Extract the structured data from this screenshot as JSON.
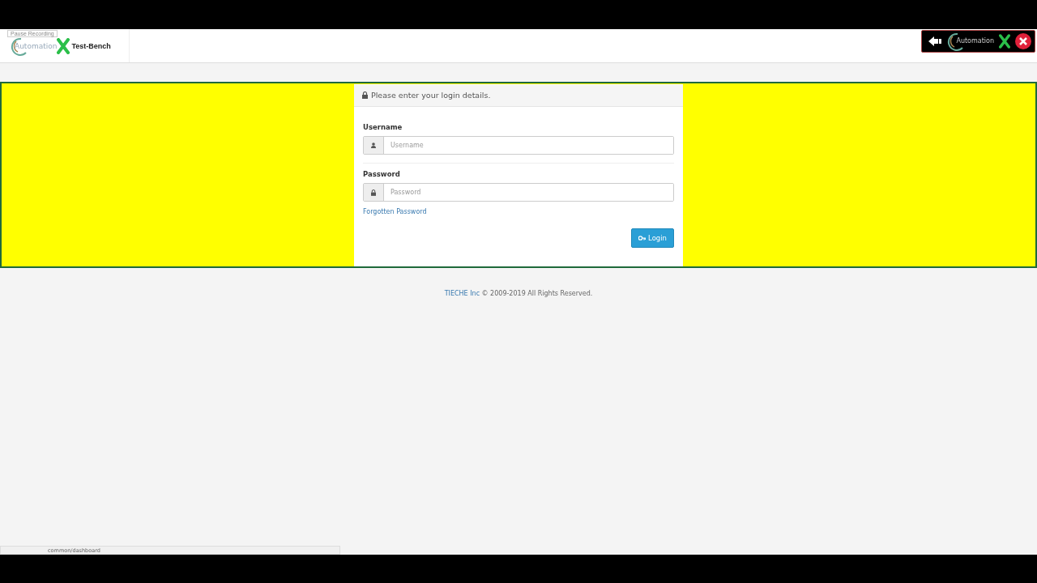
{
  "recorder": {
    "tooltip": "Pause Recording"
  },
  "header": {
    "logo_text": "Automation",
    "title": "Test-Bench"
  },
  "toolbar": {
    "logo_text": "Automation"
  },
  "login": {
    "heading": "Please enter your login details.",
    "fields": [
      {
        "kind": "text",
        "label": "Username",
        "placeholder": "Username"
      },
      {
        "kind": "password",
        "label": "Password",
        "placeholder": "Password"
      }
    ],
    "forgot_link": "Forgotten Password",
    "button": "Login"
  },
  "footer": {
    "company": "TIECHE Inc",
    "notice": "© 2009-2019 All Rights Reserved."
  },
  "status_bar": {
    "url": "common/dashboard"
  }
}
